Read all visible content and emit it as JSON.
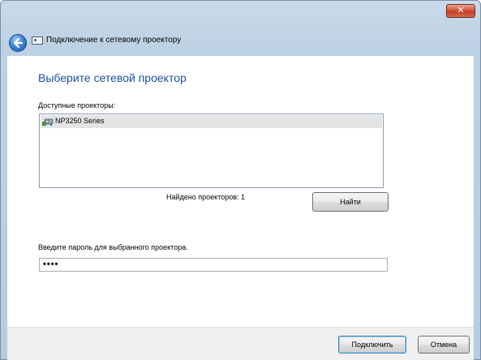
{
  "window": {
    "title": "Подключение к сетевому проектору",
    "close_label": "✕"
  },
  "page": {
    "heading": "Выберите сетевой проектор",
    "available_label": "Доступные проекторы:",
    "projectors": [
      {
        "name": "NP3250 Series",
        "icon": "network-projector-icon",
        "selected": true
      }
    ],
    "found_text": "Найдено проекторов: 1",
    "find_button": "Найти",
    "password_label": "Введите пароль для выбранного проектора.",
    "password_value": "••••"
  },
  "footer": {
    "connect_button": "Подключить",
    "cancel_button": "Отмена"
  }
}
